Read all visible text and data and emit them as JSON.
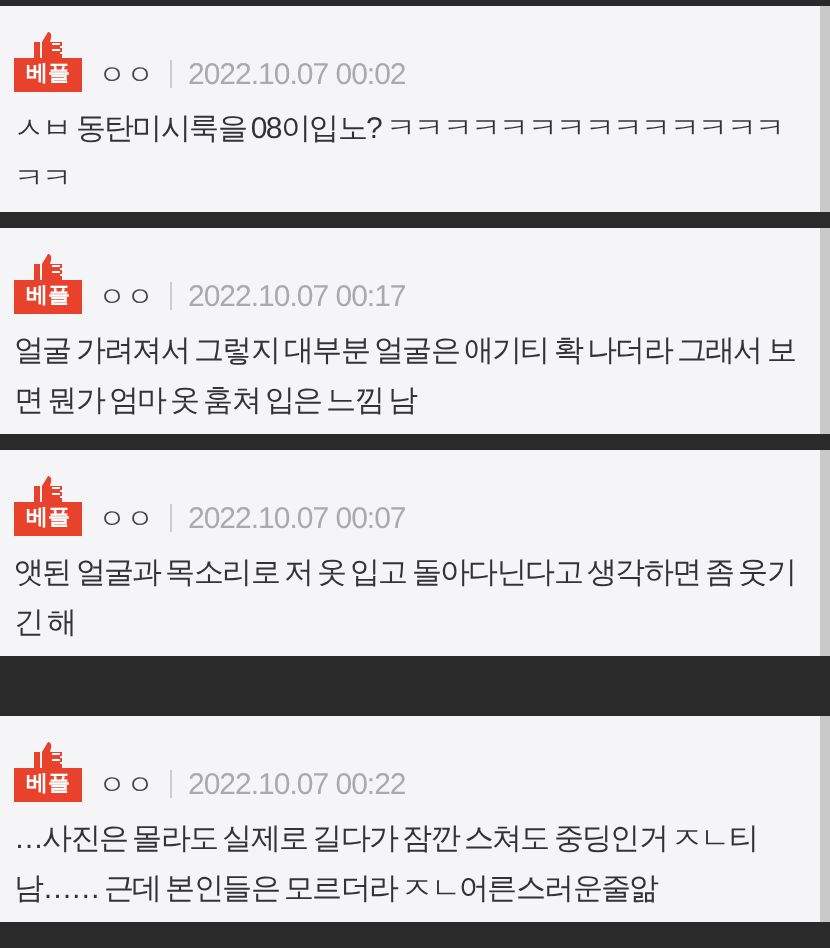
{
  "comments": [
    {
      "badge": "베플",
      "author": "ㅇㅇ",
      "date": "2022.10.07 00:02",
      "text": "ㅅㅂ 동탄미시룩을 08이입노? ㅋㅋㅋㅋㅋㅋㅋㅋㅋㅋㅋㅋㅋㅋㅋㅋ"
    },
    {
      "badge": "베플",
      "author": "ㅇㅇ",
      "date": "2022.10.07 00:17",
      "text": "얼굴 가려져서 그렇지 대부분 얼굴은 애기티 확 나더라 그래서 보면 뭔가 엄마 옷 훔쳐 입은 느낌 남"
    },
    {
      "badge": "베플",
      "author": "ㅇㅇ",
      "date": "2022.10.07 00:07",
      "text": "앳된 얼굴과 목소리로 저 옷 입고 돌아다닌다고 생각하면 좀 웃기긴 해"
    },
    {
      "badge": "베플",
      "author": "ㅇㅇ",
      "date": "2022.10.07 00:22",
      "text": "…사진은 몰라도 실제로 길다가 잠깐 스쳐도 중딩인거 ㅈㄴ티남…… 근데 본인들은 모르더라 ㅈㄴ어른스러운줄앎"
    }
  ]
}
